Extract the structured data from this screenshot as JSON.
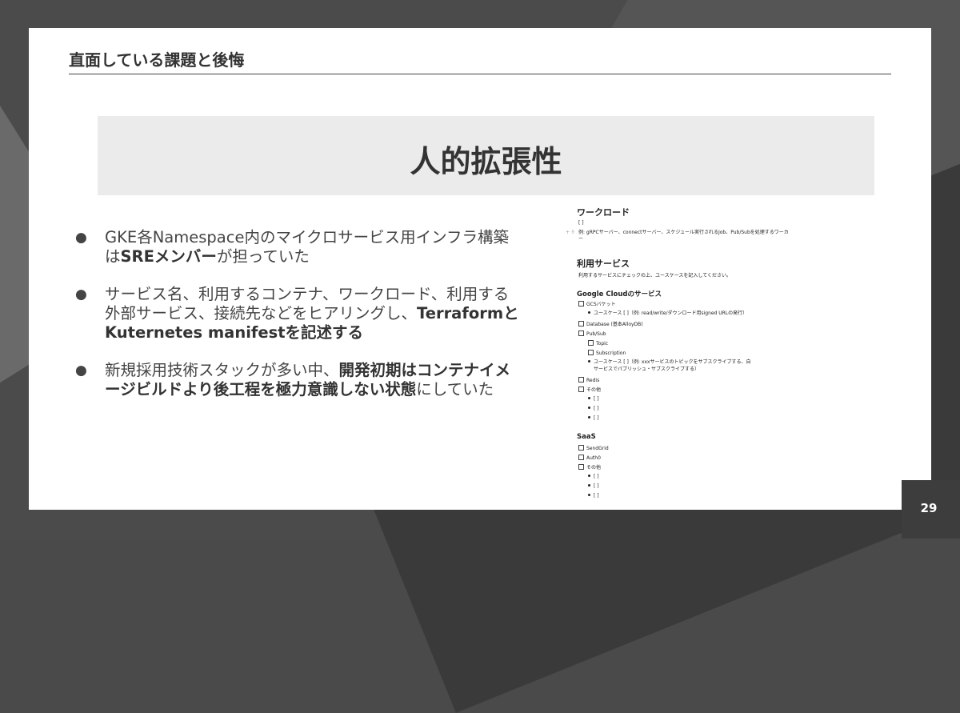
{
  "slide": {
    "title": "直面している課題と後悔",
    "banner": "人的拡張性",
    "page_number": "29"
  },
  "bullets": [
    {
      "parts": [
        {
          "text": "GKE各Namespace内のマイクロサービス用インフラ構築は",
          "bold": false
        },
        {
          "text": "SREメンバー",
          "bold": true
        },
        {
          "text": "が担っていた",
          "bold": false
        }
      ]
    },
    {
      "parts": [
        {
          "text": "サービス名、利用するコンテナ、ワークロード、利用する外部サービス、接続先などをヒアリングし、",
          "bold": false
        },
        {
          "text": "TerraformとKuternetes manifestを記述する",
          "bold": true
        }
      ]
    },
    {
      "parts": [
        {
          "text": "新規採用技術スタックが多い中、",
          "bold": false
        },
        {
          "text": "開発初期はコンテナイメージビルドより後工程を極力意識しない状態",
          "bold": true
        },
        {
          "text": "にしていた",
          "bold": false
        }
      ]
    }
  ],
  "doc": {
    "workload_heading": "ワークロード",
    "workload_bracket": "[                    ]",
    "workload_example": "例: gRPCサーバー、connectサーバー、スケジュール実行されるJob、Pub/Subを処理するワーカ",
    "workload_example_cont": "ー",
    "services_heading": "利用サービス",
    "services_note": "利用するサービスにチェックの上、ユースケースを記入してください。",
    "gcloud_heading": "Google Cloudのサービス",
    "gcs": "GCSバケット",
    "gcs_usecase": "ユースケース [                         ]（例: read/write/ダウンロード用signed URLの発行）",
    "database": "Database (基本AlloyDB)",
    "pubsub": "Pub/Sub",
    "topic": "Topic",
    "subscription": "Subscription",
    "pubsub_usecase": "ユースケース [                         ]（例: xxxサービスのトピックをサブスクライブする、自",
    "pubsub_usecase_cont": "サービスでパブリッシュ・サブスクライブする）",
    "redis": "Redis",
    "other1": "その他",
    "other_items1": [
      "[                    ]",
      "[                    ]",
      "[                    ]"
    ],
    "saas_heading": "SaaS",
    "sendgrid": "SendGrid",
    "auth0": "Auth0",
    "other2": "その他",
    "other_items2": [
      "[                    ]",
      "[                    ]",
      "[                    ]"
    ],
    "drag_handle": "+ ⠿"
  }
}
